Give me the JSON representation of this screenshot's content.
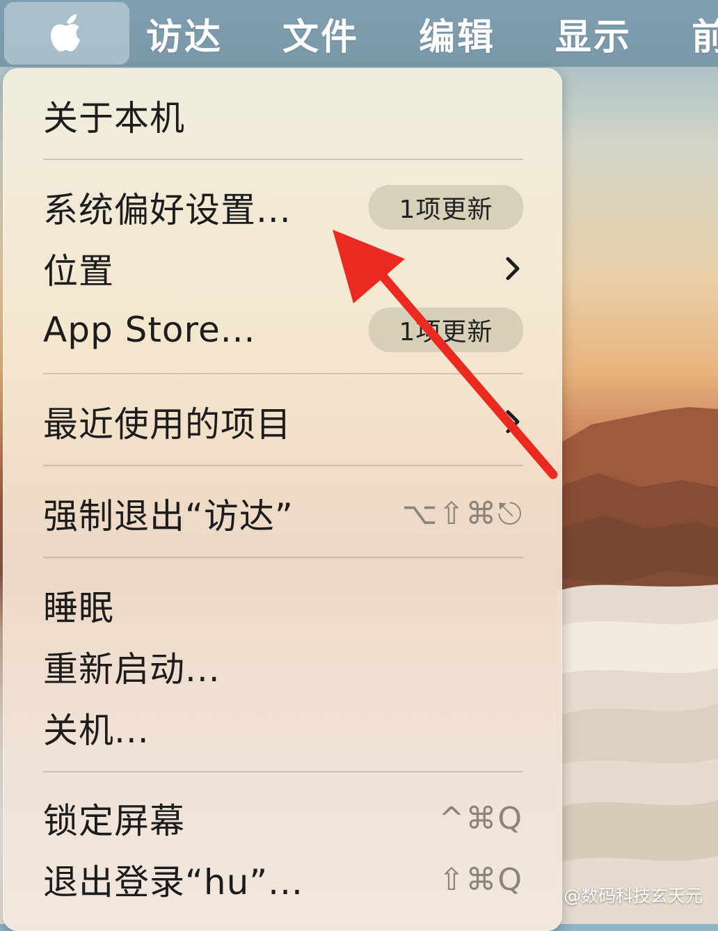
{
  "menubar": {
    "items": [
      {
        "label": "访达"
      },
      {
        "label": "文件"
      },
      {
        "label": "编辑"
      },
      {
        "label": "显示"
      },
      {
        "label": "前往"
      }
    ]
  },
  "apple_menu": {
    "items": {
      "about": {
        "label": "关于本机"
      },
      "system_prefs": {
        "label": "系统偏好设置...",
        "badge": "1项更新"
      },
      "location": {
        "label": "位置"
      },
      "app_store": {
        "label": "App Store...",
        "badge": "1项更新"
      },
      "recent": {
        "label": "最近使用的项目"
      },
      "force_quit": {
        "label": "强制退出“访达”",
        "shortcut": "⌥⇧⌘⎋"
      },
      "sleep": {
        "label": "睡眠"
      },
      "restart": {
        "label": "重新启动..."
      },
      "shutdown": {
        "label": "关机..."
      },
      "lock_screen": {
        "label": "锁定屏幕",
        "shortcut": "^⌘Q"
      },
      "logout": {
        "label": "退出登录“hu”...",
        "shortcut": "⇧⌘Q"
      }
    }
  },
  "watermark": {
    "text": "@数码科技玄天元"
  },
  "colors": {
    "menubar": "#7f9fb0",
    "annotation_arrow": "#ea2a20",
    "menu_text": "#1c1c1c",
    "shortcut_text": "#8b8579"
  }
}
